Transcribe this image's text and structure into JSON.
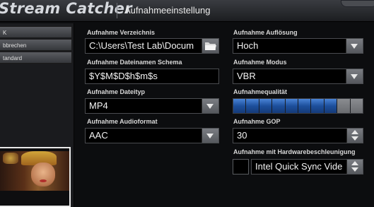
{
  "header": {
    "app_title": "Stream Catcher",
    "page_title": "Aufnahmeeinstellung"
  },
  "sidebar": {
    "items": [
      {
        "label": "K"
      },
      {
        "label": "bbrechen"
      },
      {
        "label": "tandard"
      }
    ]
  },
  "settings": {
    "directory": {
      "label": "Aufnahme Verzeichnis",
      "value": "C:\\Users\\Test Lab\\Docum",
      "icon": "folder-icon"
    },
    "filename_schema": {
      "label": "Aufnahme Dateinamen Schema",
      "value": "$Y$M$D$h$m$s"
    },
    "filetype": {
      "label": "Aufnahme Dateityp",
      "value": "MP4"
    },
    "audioformat": {
      "label": "Aufnahme Audioformat",
      "value": "AAC"
    },
    "resolution": {
      "label": "Aufnahme Auflösung",
      "value": "Hoch"
    },
    "mode": {
      "label": "Aufnahme Modus",
      "value": "VBR"
    },
    "quality": {
      "label": "Aufnahmequalität",
      "level": 0.8,
      "segments": 10,
      "active_color": "#2a62b8",
      "inactive_color": "#7a7c80"
    },
    "gop": {
      "label": "Aufnahme GOP",
      "value": "30"
    },
    "hw_accel": {
      "label": "Aufnahme mit Hardwarebeschleunigung",
      "checked": false,
      "value": "Intel Quick Sync Vide"
    }
  }
}
